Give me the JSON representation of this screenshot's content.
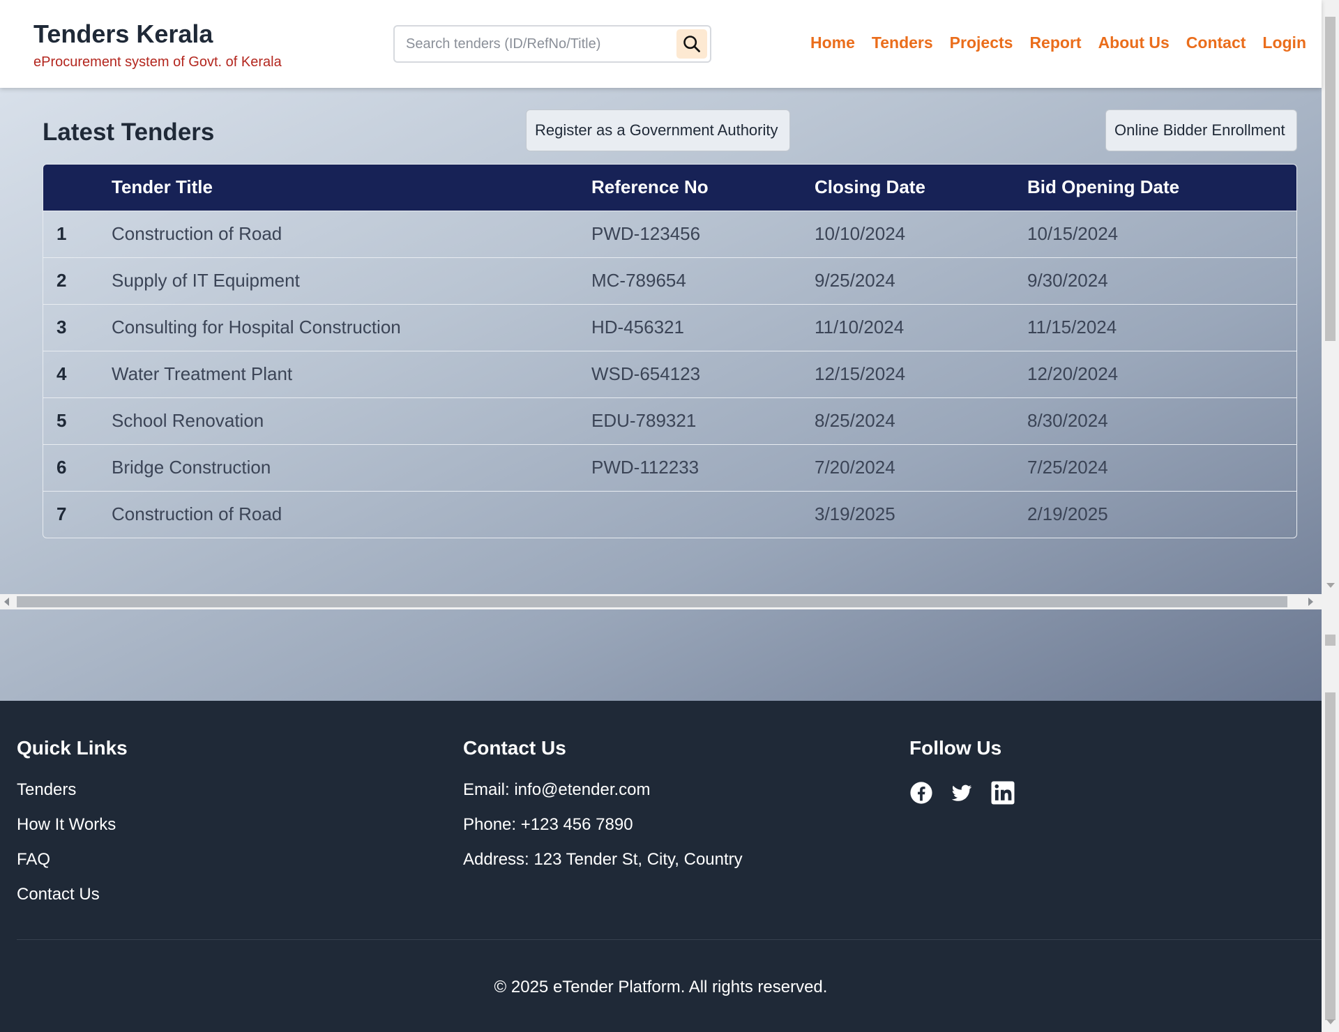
{
  "header": {
    "brand_title": "Tenders Kerala",
    "brand_subtitle": "eProcurement system of Govt. of Kerala",
    "search_placeholder": "Search tenders (ID/RefNo/Title)",
    "nav": [
      "Home",
      "Tenders",
      "Projects",
      "Report",
      "About Us",
      "Contact",
      "Login"
    ]
  },
  "main": {
    "title": "Latest Tenders",
    "register_button": "Register as a Government Authority",
    "enroll_button": "Online Bidder Enrollment",
    "columns": [
      "Tender Title",
      "Reference No",
      "Closing Date",
      "Bid Opening Date"
    ],
    "rows": [
      {
        "num": "1",
        "title": "Construction of Road",
        "ref": "PWD-123456",
        "closing": "10/10/2024",
        "opening": "10/15/2024"
      },
      {
        "num": "2",
        "title": "Supply of IT Equipment",
        "ref": "MC-789654",
        "closing": "9/25/2024",
        "opening": "9/30/2024"
      },
      {
        "num": "3",
        "title": "Consulting for Hospital Construction",
        "ref": "HD-456321",
        "closing": "11/10/2024",
        "opening": "11/15/2024"
      },
      {
        "num": "4",
        "title": "Water Treatment Plant",
        "ref": "WSD-654123",
        "closing": "12/15/2024",
        "opening": "12/20/2024"
      },
      {
        "num": "5",
        "title": "School Renovation",
        "ref": "EDU-789321",
        "closing": "8/25/2024",
        "opening": "8/30/2024"
      },
      {
        "num": "6",
        "title": "Bridge Construction",
        "ref": "PWD-112233",
        "closing": "7/20/2024",
        "opening": "7/25/2024"
      },
      {
        "num": "7",
        "title": "Construction of Road",
        "ref": "",
        "closing": "3/19/2025",
        "opening": "2/19/2025"
      }
    ]
  },
  "footer": {
    "quick_links_title": "Quick Links",
    "quick_links": [
      "Tenders",
      "How It Works",
      "FAQ",
      "Contact Us"
    ],
    "contact_title": "Contact Us",
    "contact_lines": [
      "Email: info@etender.com",
      "Phone: +123 456 7890",
      "Address: 123 Tender St, City, Country"
    ],
    "follow_title": "Follow Us",
    "social_icons": [
      "facebook-icon",
      "twitter-icon",
      "linkedin-icon"
    ],
    "copyright": "© 2025 eTender Platform. All rights reserved."
  },
  "colors": {
    "accent": "#ea6d1b",
    "table_header": "#172256",
    "footer_bg": "#1f2937",
    "subtitle": "#b3261e"
  }
}
